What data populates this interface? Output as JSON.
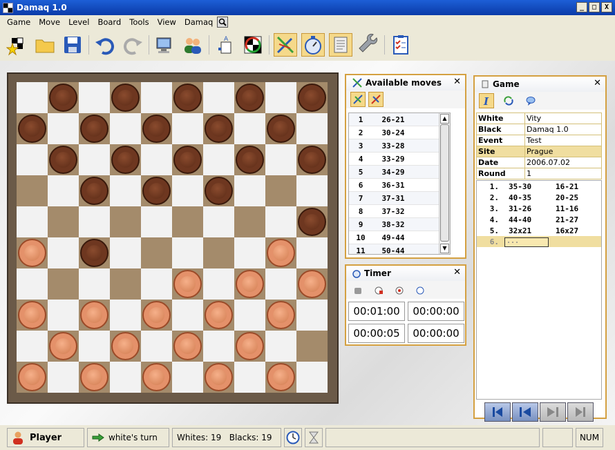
{
  "window": {
    "title": "Damaq 1.0",
    "min": "_",
    "max": "□",
    "close": "X"
  },
  "menu": [
    "Game",
    "Move",
    "Level",
    "Board",
    "Tools",
    "View",
    "Damaq"
  ],
  "toolbar": {
    "active": [
      "analysis",
      "timer",
      "notation"
    ]
  },
  "board": {
    "rows": [
      "-b-b-b-b-b",
      "b-b-b-b-b-",
      "-b-b-b-b-b",
      "--b-b-b---",
      "---------b",
      "w-b-----w-",
      "-----w-w-w",
      "w-w-w-w-w-",
      "-w-w-w-w--",
      "w-w-w-w-w-"
    ],
    "colors": {
      "light": "#f2f2f2",
      "dark": "#a48b6b"
    }
  },
  "moves_panel": {
    "title": "Available moves",
    "close": "✕",
    "items": [
      {
        "n": "1",
        "m": "26-21"
      },
      {
        "n": "2",
        "m": "30-24"
      },
      {
        "n": "3",
        "m": "33-28"
      },
      {
        "n": "4",
        "m": "33-29"
      },
      {
        "n": "5",
        "m": "34-29"
      },
      {
        "n": "6",
        "m": "36-31"
      },
      {
        "n": "7",
        "m": "37-31"
      },
      {
        "n": "8",
        "m": "37-32"
      },
      {
        "n": "9",
        "m": "38-32"
      },
      {
        "n": "10",
        "m": "49-44"
      },
      {
        "n": "11",
        "m": "50-44"
      }
    ]
  },
  "timer_panel": {
    "title": "Timer",
    "close": "✕",
    "values": [
      "00:01:00",
      "00:00:00",
      "00:00:05",
      "00:00:00"
    ]
  },
  "game_panel": {
    "title": "Game",
    "close": "✕",
    "tags": [
      {
        "k": "White",
        "v": "Vity"
      },
      {
        "k": "Black",
        "v": "Damaq 1.0"
      },
      {
        "k": "Event",
        "v": "Test"
      },
      {
        "k": "Site",
        "v": "Prague"
      },
      {
        "k": "Date",
        "v": "2006.07.02"
      },
      {
        "k": "Round",
        "v": "1"
      }
    ],
    "moves": [
      {
        "n": "1.",
        "w": "35-30",
        "b": "16-21"
      },
      {
        "n": "2.",
        "w": "40-35",
        "b": "20-25"
      },
      {
        "n": "3.",
        "w": "31-26",
        "b": "11-16"
      },
      {
        "n": "4.",
        "w": "44-40",
        "b": "21-27"
      },
      {
        "n": "5.",
        "w": "32x21",
        "b": "16x27"
      }
    ],
    "current": {
      "n": "6.",
      "w": "..."
    }
  },
  "status": {
    "player": "Player",
    "turn": "white's turn",
    "counts": "Whites: 19   Blacks: 19",
    "num": "NUM"
  }
}
